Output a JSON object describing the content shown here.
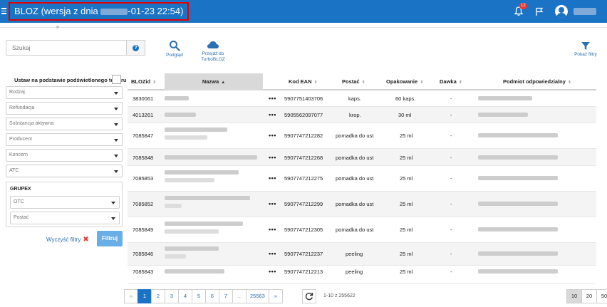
{
  "header": {
    "title_prefix": "BLOZ (wersja z dnia ",
    "title_suffix": "-01-23 22:54)",
    "notification_count": "12",
    "icons": [
      "menu-icon",
      "bell-icon",
      "flag-icon",
      "user-avatar-icon"
    ]
  },
  "search": {
    "placeholder": "Szukaj",
    "help_label": "?"
  },
  "toolbar": {
    "preview_label": "Podgląd",
    "turbo_label": "Przejdź do TurboBLOZ",
    "filters_label": "Pokaż filtry"
  },
  "filters": {
    "title": "Ustaw na podstawie podświetlonego towaru",
    "selects": [
      "Rodzaj",
      "Refundacja",
      "Substancja aktywna",
      "Producent",
      "Koncern",
      "ATC"
    ],
    "grupex_title": "GRUPEX",
    "grupex_selects": [
      "OTC",
      "Postać"
    ],
    "clear_label": "Wyczyść filtry",
    "apply_label": "Filtruj"
  },
  "table": {
    "columns": [
      {
        "label": "BLOZid",
        "sort": "⬍"
      },
      {
        "label": "Nazwa",
        "sort": "▲"
      },
      {
        "label": "Kod EAN",
        "sort": "⬍"
      },
      {
        "label": "Postać",
        "sort": "⬍"
      },
      {
        "label": "Opakowanie",
        "sort": "⬍"
      },
      {
        "label": "Dawka",
        "sort": "⬍"
      },
      {
        "label": "Podmiot odpowiedzialny",
        "sort": "⬍"
      }
    ],
    "rows": [
      {
        "id": "3830061",
        "ean": "5907751403706",
        "form": "kaps.",
        "pack": "60 kaps.",
        "dose": "-"
      },
      {
        "id": "4013261",
        "ean": "5905562097077",
        "form": "krop.",
        "pack": "30 ml",
        "dose": "-"
      },
      {
        "id": "7085847",
        "ean": "5907747212282",
        "form": "pomadka do ust",
        "pack": "25 ml",
        "dose": "-"
      },
      {
        "id": "7085848",
        "ean": "5907747212268",
        "form": "pomadka do ust",
        "pack": "25 ml",
        "dose": "-"
      },
      {
        "id": "7085853",
        "ean": "5907747212275",
        "form": "pomadka do ust",
        "pack": "25 ml",
        "dose": "-"
      },
      {
        "id": "7085852",
        "ean": "5907747212299",
        "form": "pomadka do ust",
        "pack": "25 ml",
        "dose": "-"
      },
      {
        "id": "7085849",
        "ean": "5907747212305",
        "form": "pomadka do ust",
        "pack": "25 ml",
        "dose": "-"
      },
      {
        "id": "7085846",
        "ean": "5907747212237",
        "form": "peeling",
        "pack": "25 ml",
        "dose": "-"
      },
      {
        "id": "7085843",
        "ean": "5907747212213",
        "form": "peeling",
        "pack": "25 ml",
        "dose": "-"
      }
    ],
    "more_label": "•••"
  },
  "pagination": {
    "prev": "«",
    "pages": [
      "1",
      "2",
      "3",
      "4",
      "5",
      "6",
      "7",
      "...",
      "25563"
    ],
    "next": "»",
    "range_text": "1-10 z 255622",
    "page_sizes": [
      "10",
      "20",
      "50"
    ]
  },
  "colors": {
    "header_bg": "#1a73c5",
    "highlight_border": "#e00000",
    "accent": "#2c6fb3"
  }
}
